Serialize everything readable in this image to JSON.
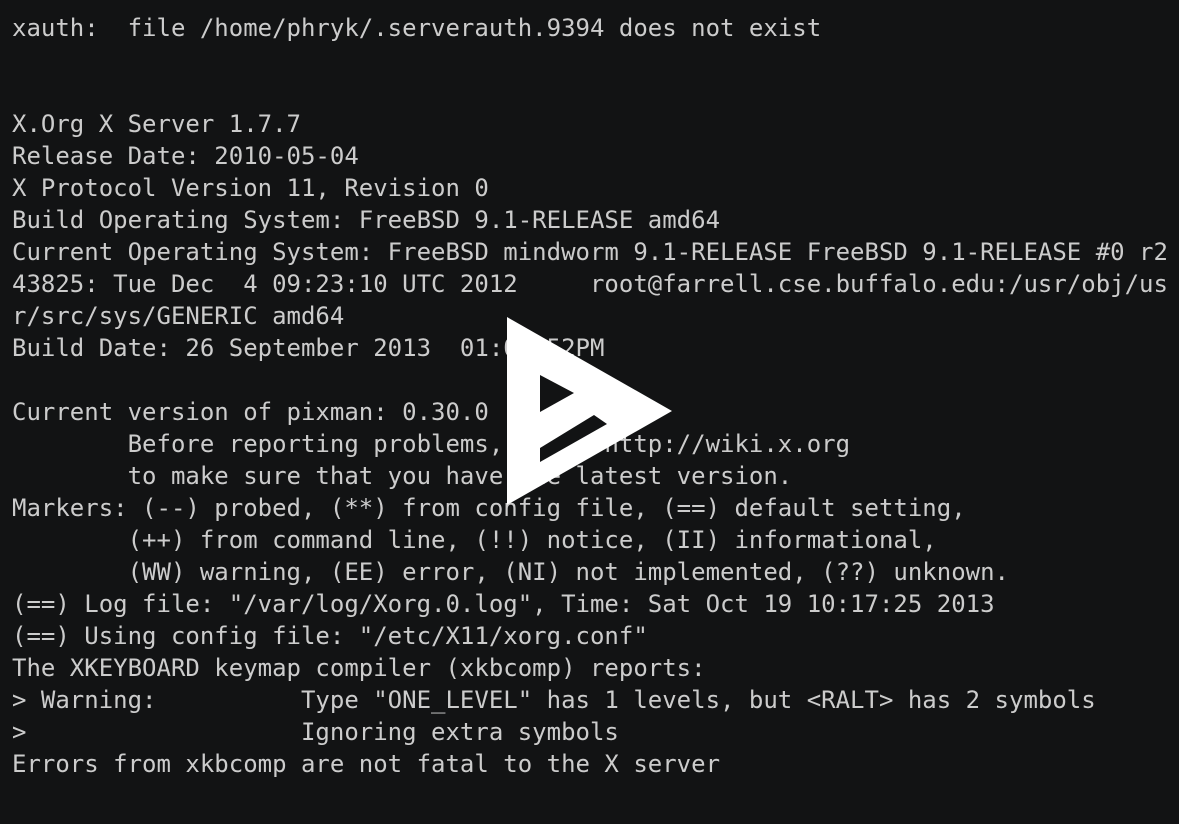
{
  "terminal": {
    "lines": [
      "xauth:  file /home/phryk/.serverauth.9394 does not exist",
      "",
      "",
      "X.Org X Server 1.7.7",
      "Release Date: 2010-05-04",
      "X Protocol Version 11, Revision 0",
      "Build Operating System: FreeBSD 9.1-RELEASE amd64",
      "Current Operating System: FreeBSD mindworm 9.1-RELEASE FreeBSD 9.1-RELEASE #0 r2",
      "43825: Tue Dec  4 09:23:10 UTC 2012     root@farrell.cse.buffalo.edu:/usr/obj/us",
      "r/src/sys/GENERIC amd64",
      "Build Date: 26 September 2013  01:05:52PM",
      "",
      "Current version of pixman: 0.30.0",
      "        Before reporting problems, check http://wiki.x.org",
      "        to make sure that you have the latest version.",
      "Markers: (--) probed, (**) from config file, (==) default setting,",
      "        (++) from command line, (!!) notice, (II) informational,",
      "        (WW) warning, (EE) error, (NI) not implemented, (??) unknown.",
      "(==) Log file: \"/var/log/Xorg.0.log\", Time: Sat Oct 19 10:17:25 2013",
      "(==) Using config file: \"/etc/X11/xorg.conf\"",
      "The XKEYBOARD keymap compiler (xkbcomp) reports:",
      "> Warning:          Type \"ONE_LEVEL\" has 1 levels, but <RALT> has 2 symbols",
      ">                   Ignoring extra symbols",
      "Errors from xkbcomp are not fatal to the X server"
    ]
  },
  "overlay": {
    "icon": "play-icon"
  },
  "colors": {
    "background": "#121314",
    "text": "#cccccc",
    "overlay": "#ffffff"
  }
}
